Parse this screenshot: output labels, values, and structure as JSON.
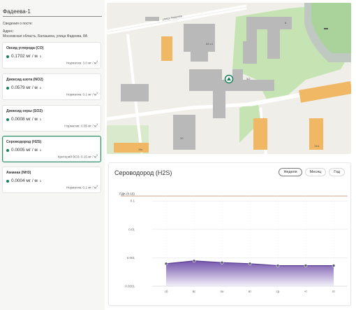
{
  "station": {
    "title": "Фадеева-1",
    "info_heading": "Сведения о посте:",
    "address_label": "Адрес:",
    "address_value": "Московская область, Балашиха, улица Фадеева, 8А"
  },
  "pollutants": [
    {
      "name": "Оксид углерода (CO)",
      "value": "0.1702 мг / м",
      "sup": "3",
      "norm": "Норматив: 3.0 мг / м",
      "norm_sup": "3",
      "active": false
    },
    {
      "name": "Диоксид азота (NO2)",
      "value": "0.0579 мг / м",
      "sup": "3",
      "norm": "Норматив: 0.1 мг / м",
      "norm_sup": "3",
      "active": false
    },
    {
      "name": "Диоксид серы (SO2)",
      "value": "0.0008 мг / м",
      "sup": "3",
      "norm": "Норматив: 0.05 мг / м",
      "norm_sup": "3",
      "active": false
    },
    {
      "name": "Сероводород (H2S)",
      "value": "0.0005 мг / м",
      "sup": "3",
      "norm": "Критерий ВОЗ: 0.15 мг / м",
      "norm_sup": "3",
      "active": true
    },
    {
      "name": "Аммиак (NH3)",
      "value": "0.0004 мг / м",
      "sup": "3",
      "norm": "Норматив: 0.1 мг / м",
      "norm_sup": "3",
      "active": false
    }
  ],
  "map": {
    "street_label": "улица Фадеева",
    "house_labels": [
      "8",
      "8А с1",
      "3/2",
      "20",
      "14А",
      "15к"
    ],
    "marker_icon": "station-marker-icon",
    "colors": {
      "bg": "#efeee8",
      "green": "#c6e4b3",
      "building": "#b9b9b9",
      "orange": "#f0b765",
      "road": "#ffffff",
      "track": "#bfc9c2"
    }
  },
  "chart": {
    "title": "Сероводород (H2S)",
    "periods": [
      {
        "label": "Неделя",
        "selected": true
      },
      {
        "label": "Месяц",
        "selected": false
      },
      {
        "label": "Год",
        "selected": false
      }
    ]
  },
  "chart_data": {
    "type": "area",
    "y_scale": "log",
    "ylim": [
      0.0001,
      0.2
    ],
    "y_ticks": [
      "0.0001",
      "0.001",
      "0.01",
      "0.1"
    ],
    "categories": [
      "сб",
      "вс",
      "пн",
      "вт",
      "ср",
      "чт",
      "пт"
    ],
    "series": [
      {
        "values": [
          0.00062,
          0.00078,
          0.00068,
          0.00062,
          0.00053,
          0.00053,
          0.00053
        ]
      }
    ],
    "reference_line": {
      "label": "ПДК (0.15)",
      "value": 0.15,
      "color": "#d9a68c"
    },
    "colors": {
      "line": "#5a3f93",
      "fill_top": "#6b4aa6",
      "fill_bottom": "#f3effa"
    }
  }
}
